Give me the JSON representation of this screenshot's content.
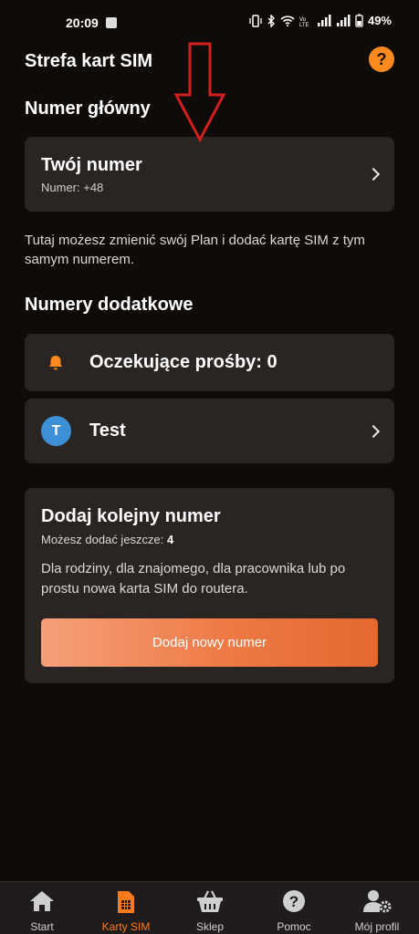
{
  "status_bar": {
    "time": "20:09",
    "battery": "49%"
  },
  "header": {
    "title": "Strefa kart SIM",
    "help_label": "?"
  },
  "main_number": {
    "section_title": "Numer główny",
    "card_title": "Twój numer",
    "card_subtitle": "Numer: +48",
    "description": "Tutaj możesz zmienić swój Plan i dodać kartę SIM z tym samym numerem."
  },
  "additional": {
    "section_title": "Numery dodatkowe",
    "pending_label": "Oczekujące prośby: 0",
    "entry": {
      "avatar_letter": "T",
      "name": "Test"
    }
  },
  "add_card": {
    "title": "Dodaj kolejny numer",
    "sub_prefix": "Możesz dodać jeszcze: ",
    "sub_count": "4",
    "description": "Dla rodziny, dla znajomego, dla pracownika lub po prostu nowa karta SIM do routera.",
    "button_label": "Dodaj nowy numer"
  },
  "nav": {
    "items": [
      {
        "label": "Start",
        "icon": "home-icon",
        "active": false
      },
      {
        "label": "Karty SIM",
        "icon": "sim-card-icon",
        "active": true
      },
      {
        "label": "Sklep",
        "icon": "basket-icon",
        "active": false
      },
      {
        "label": "Pomoc",
        "icon": "help-icon",
        "active": false
      },
      {
        "label": "Mój profil",
        "icon": "profile-settings-icon",
        "active": false
      }
    ]
  },
  "colors": {
    "accent": "#ff8a1f",
    "card_bg": "#2a2523",
    "page_bg": "#0f0b09",
    "arrow": "#d11f1f"
  }
}
